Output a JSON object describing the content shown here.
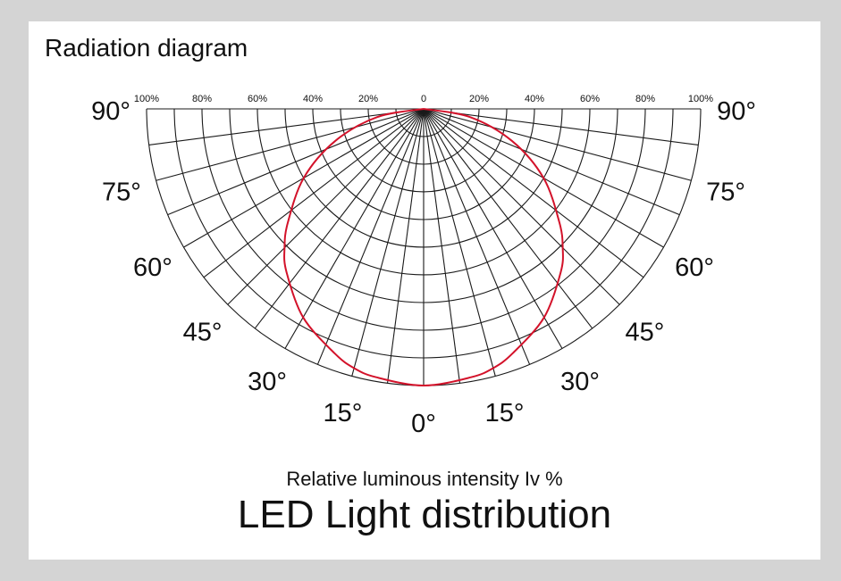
{
  "page": {
    "title": "Radiation diagram",
    "caption": "Relative luminous intensity Iv %",
    "heading": "LED Light distribution"
  },
  "colors": {
    "background": "#d4d4d4",
    "panel": "#ffffff",
    "grid": "#1a1a1a",
    "curve": "#d3122a"
  },
  "chart_data": {
    "type": "polar",
    "title": "Radiation diagram",
    "xlabel": "Relative luminous intensity Iv %",
    "radial_tick_labels_left": [
      "100%",
      "80%",
      "60%",
      "40%",
      "20%"
    ],
    "radial_tick_label_center": "0",
    "radial_tick_labels_right": [
      "20%",
      "40%",
      "60%",
      "80%",
      "100%"
    ],
    "radial_range": [
      0,
      100
    ],
    "radial_circles_percent": [
      10,
      20,
      30,
      40,
      50,
      60,
      70,
      80,
      90,
      100
    ],
    "angle_range_deg": [
      -90,
      90
    ],
    "angle_grid_step_deg": 7.5,
    "angle_tick_labels_left": [
      "90°",
      "75°",
      "60°",
      "45°",
      "30°",
      "15°"
    ],
    "angle_tick_label_center": "0°",
    "angle_tick_labels_right": [
      "15°",
      "30°",
      "45°",
      "60°",
      "75°",
      "90°"
    ],
    "legend": "none",
    "series": [
      {
        "angle_deg": [
          -90,
          -80,
          -70,
          -60,
          -50,
          -45,
          -40,
          -30,
          -20,
          -15,
          -10,
          0,
          10,
          15,
          20,
          30,
          40,
          45,
          50,
          60,
          70,
          80,
          90
        ],
        "intensity_percent": [
          0,
          17,
          34,
          50,
          64,
          71,
          77,
          87,
          94,
          97,
          98.5,
          100,
          98.5,
          97,
          94,
          87,
          77,
          71,
          64,
          50,
          34,
          17,
          0
        ]
      }
    ]
  }
}
